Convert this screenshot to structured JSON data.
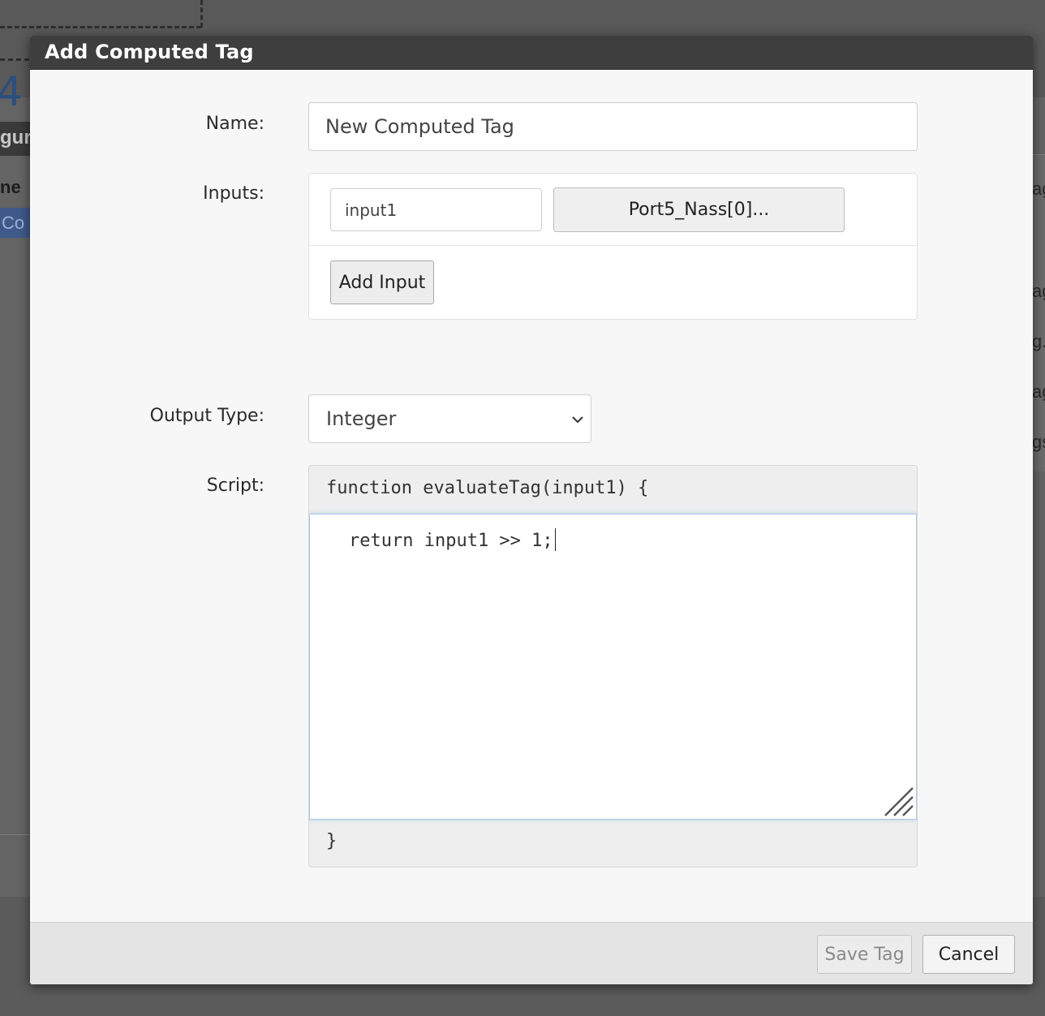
{
  "background": {
    "partial_number": "4",
    "partial_heading": "gur",
    "partial_column": "ne",
    "partial_row": "Co",
    "right_fragments": [
      "ag",
      "ag",
      "g.",
      "ag",
      "gs"
    ]
  },
  "modal": {
    "title": "Add Computed Tag",
    "name_label": "Name:",
    "name_value": "New Computed Tag",
    "inputs_label": "Inputs:",
    "inputs": [
      {
        "variable": "input1",
        "tag_button": "Port5_Nass[0]..."
      }
    ],
    "add_input_label": "Add Input",
    "output_type_label": "Output Type:",
    "output_type_value": "Integer",
    "script_label": "Script:",
    "script_header": "function evaluateTag(input1) {",
    "script_body": "return input1 >> 1;",
    "script_footer": "}",
    "save_label": "Save Tag",
    "cancel_label": "Cancel"
  },
  "colors": {
    "header_bg": "#3e3e3e",
    "modal_bg": "#f7f7f7",
    "editor_focus": "#a9c8e6"
  },
  "icons": {
    "select": "chevron-down-icon",
    "editor": "resize-grip-icon"
  }
}
